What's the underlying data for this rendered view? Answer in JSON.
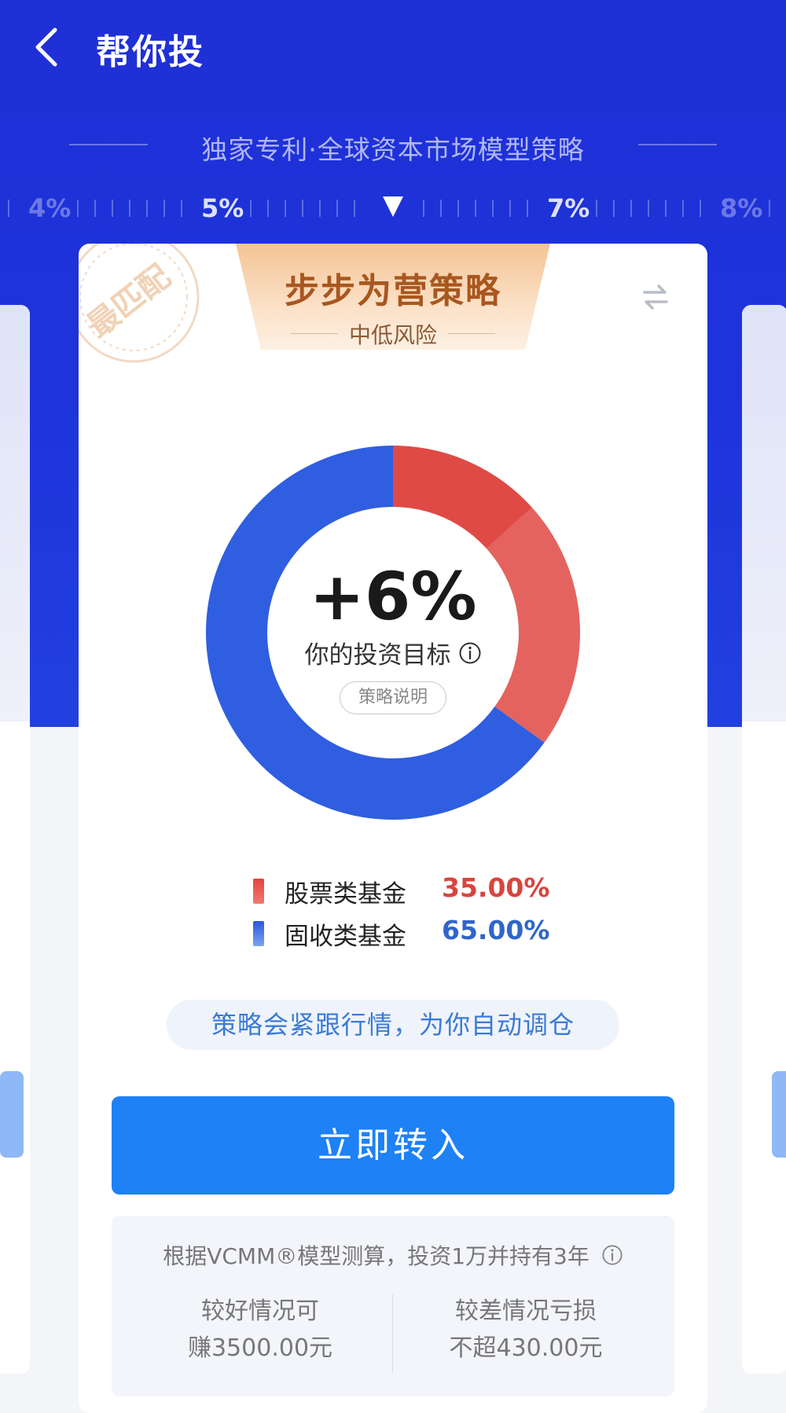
{
  "header": {
    "title": "帮你投"
  },
  "subtitle": "独家专利·全球资本市场模型策略",
  "rate_scale": {
    "labels": [
      "4%",
      "5%",
      "7%",
      "8%"
    ],
    "selected": "6%"
  },
  "card": {
    "stamp": "最匹配",
    "strategy_name": "步步为营策略",
    "risk_level": "中低风险",
    "target_value": "+6%",
    "target_label": "你的投资目标",
    "explain_button": "策略说明",
    "allocation": [
      {
        "name": "股票类基金",
        "percent": "35.00%",
        "value": 35,
        "color": "#e04a45"
      },
      {
        "name": "固收类基金",
        "percent": "65.00%",
        "value": 65,
        "color": "#2f5ee0"
      }
    ],
    "rebalance_note": "策略会紧跟行情，为你自动调仓",
    "cta_button": "立即转入",
    "estimate": {
      "title": "根据VCMM®模型测算，投资1万并持有3年",
      "good_line1": "较好情况可",
      "good_line2": "赚3500.00元",
      "bad_line1": "较差情况亏损",
      "bad_line2": "不超430.00元"
    }
  },
  "colors": {
    "primary_blue": "#1e81f6",
    "header_blue": "#1f2fd6",
    "stock_red": "#e04a45",
    "bond_blue": "#2f5ee0",
    "banner_brown": "#a8571f"
  }
}
